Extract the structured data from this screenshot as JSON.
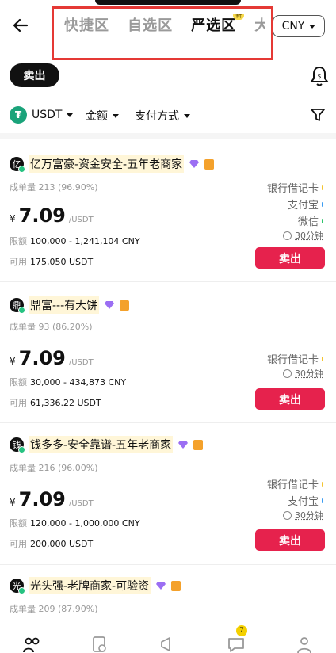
{
  "header": {
    "tabs": [
      {
        "label": "快捷区",
        "active": false
      },
      {
        "label": "自选区",
        "active": false
      },
      {
        "label": "严选区",
        "active": true,
        "badge": "新"
      },
      {
        "label": "大宗",
        "active": false
      }
    ],
    "currency": "CNY"
  },
  "mode_pill": "卖出",
  "filters": {
    "coin": "USDT",
    "coin_icon": "tether-icon",
    "amount": "金额",
    "payment": "支付方式"
  },
  "listings": [
    {
      "avatar": "亿",
      "name": "亿万富豪-资金安全-五年老商家",
      "stats_label": "成单量",
      "stats_value": "213 (96.90%)",
      "yen": "¥",
      "price": "7.09",
      "price_unit": "/USDT",
      "limit_label": "限额",
      "limit_value": "100,000 - 1,241,104 CNY",
      "avail_label": "可用",
      "avail_value": "175,050 USDT",
      "payments": [
        {
          "label": "银行借记卡",
          "color": "#f4c430"
        },
        {
          "label": "支付宝",
          "color": "#3b9cf2"
        },
        {
          "label": "微信",
          "color": "#2ec46b"
        }
      ],
      "time": "30分钟",
      "button": "卖出"
    },
    {
      "avatar": "鼎",
      "name": "鼎富---有大饼",
      "stats_label": "成单量",
      "stats_value": "93 (86.20%)",
      "yen": "¥",
      "price": "7.09",
      "price_unit": "/USDT",
      "limit_label": "限额",
      "limit_value": "30,000 - 434,873 CNY",
      "avail_label": "可用",
      "avail_value": "61,336.22 USDT",
      "payments": [
        {
          "label": "银行借记卡",
          "color": "#f4c430"
        }
      ],
      "time": "30分钟",
      "button": "卖出"
    },
    {
      "avatar": "钱",
      "name": "钱多多-安全靠谱-五年老商家",
      "stats_label": "成单量",
      "stats_value": "216 (96.00%)",
      "yen": "¥",
      "price": "7.09",
      "price_unit": "/USDT",
      "limit_label": "限额",
      "limit_value": "120,000 - 1,000,000 CNY",
      "avail_label": "可用",
      "avail_value": "200,000 USDT",
      "payments": [
        {
          "label": "银行借记卡",
          "color": "#f4c430"
        },
        {
          "label": "支付宝",
          "color": "#3b9cf2"
        }
      ],
      "time": "30分钟",
      "button": "卖出"
    },
    {
      "avatar": "光",
      "name": "光头强-老牌商家-可验资",
      "stats_label": "成单量",
      "stats_value": "209 (87.90%)"
    }
  ],
  "bottom_nav": {
    "badge_count": "7"
  }
}
